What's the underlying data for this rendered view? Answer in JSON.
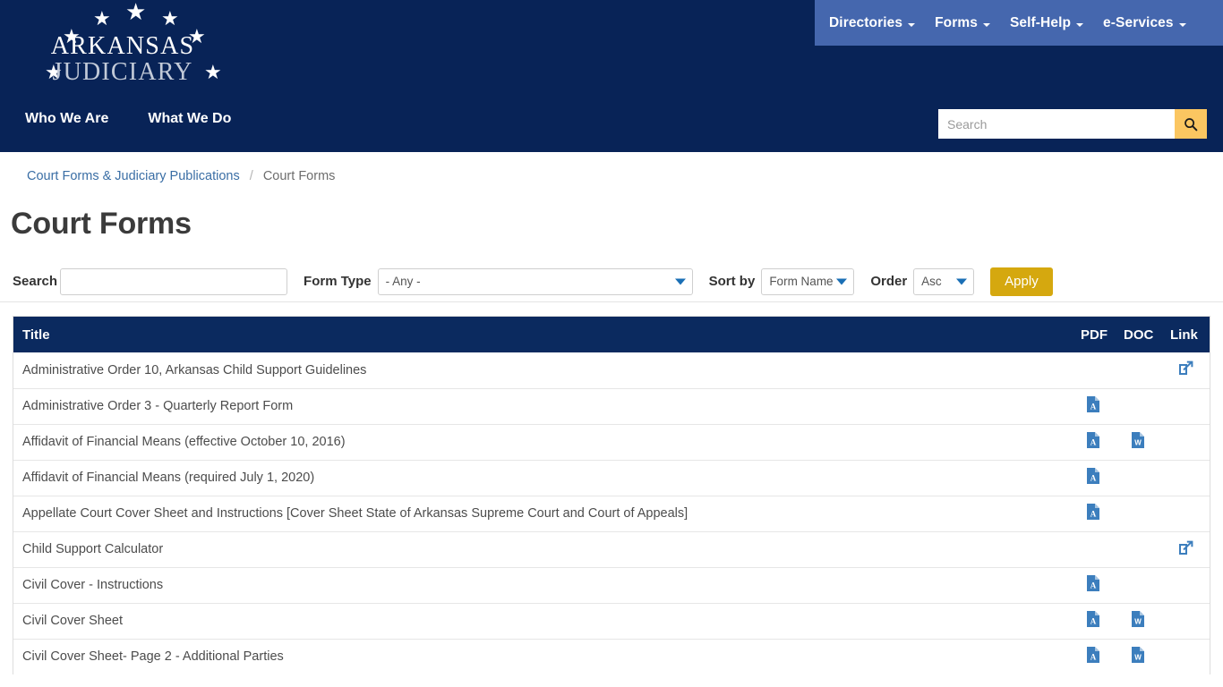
{
  "header": {
    "logo": {
      "line1": "ARKANSAS",
      "line2": "JUDICIARY",
      "star_glyph": "★"
    },
    "topnav": [
      {
        "label": "Directories",
        "icon": "chevron-down-icon"
      },
      {
        "label": "Forms",
        "icon": "chevron-down-icon"
      },
      {
        "label": "Self-Help",
        "icon": "chevron-down-icon"
      },
      {
        "label": "e-Services",
        "icon": "chevron-down-icon"
      }
    ],
    "mainnav": [
      {
        "label": "Who We Are"
      },
      {
        "label": "What We Do"
      }
    ],
    "search": {
      "value": "",
      "placeholder": "Search",
      "button_icon": "search-icon"
    },
    "colors": {
      "header_bg": "#082357",
      "topnav_bg": "#4567ae",
      "search_button": "#fbc661"
    }
  },
  "breadcrumb": {
    "parent": "Court Forms & Judiciary Publications",
    "separator": "/",
    "current": "Court Forms"
  },
  "page": {
    "title": "Court Forms"
  },
  "filters": {
    "search_label": "Search",
    "search_value": "",
    "search_placeholder": "",
    "form_type_label": "Form Type",
    "form_type_value": "- Any -",
    "sort_by_label": "Sort by",
    "sort_by_value": "Form Name",
    "order_label": "Order",
    "order_value": "Asc",
    "apply_label": "Apply",
    "apply_color": "#d5a80f"
  },
  "table": {
    "header_bg": "#0b2a5f",
    "columns": {
      "title": "Title",
      "pdf": "PDF",
      "doc": "DOC",
      "link": "Link"
    },
    "icon_color": "#3c7ebd",
    "rows": [
      {
        "title": "Administrative Order 10, Arkansas Child Support Guidelines",
        "pdf": false,
        "doc": false,
        "link": true
      },
      {
        "title": "Administrative Order 3 - Quarterly Report Form",
        "pdf": true,
        "doc": false,
        "link": false
      },
      {
        "title": "Affidavit of Financial Means (effective October 10, 2016)",
        "pdf": true,
        "doc": true,
        "link": false
      },
      {
        "title": "Affidavit of Financial Means (required July 1, 2020)",
        "pdf": true,
        "doc": false,
        "link": false
      },
      {
        "title": "Appellate Court Cover Sheet and Instructions [Cover Sheet State of Arkansas Supreme Court and Court of Appeals]",
        "pdf": true,
        "doc": false,
        "link": false
      },
      {
        "title": "Child Support Calculator",
        "pdf": false,
        "doc": false,
        "link": true
      },
      {
        "title": "Civil Cover - Instructions",
        "pdf": true,
        "doc": false,
        "link": false
      },
      {
        "title": "Civil Cover Sheet",
        "pdf": true,
        "doc": true,
        "link": false
      },
      {
        "title": "Civil Cover Sheet- Page 2 - Additional Parties",
        "pdf": true,
        "doc": true,
        "link": false
      }
    ]
  }
}
